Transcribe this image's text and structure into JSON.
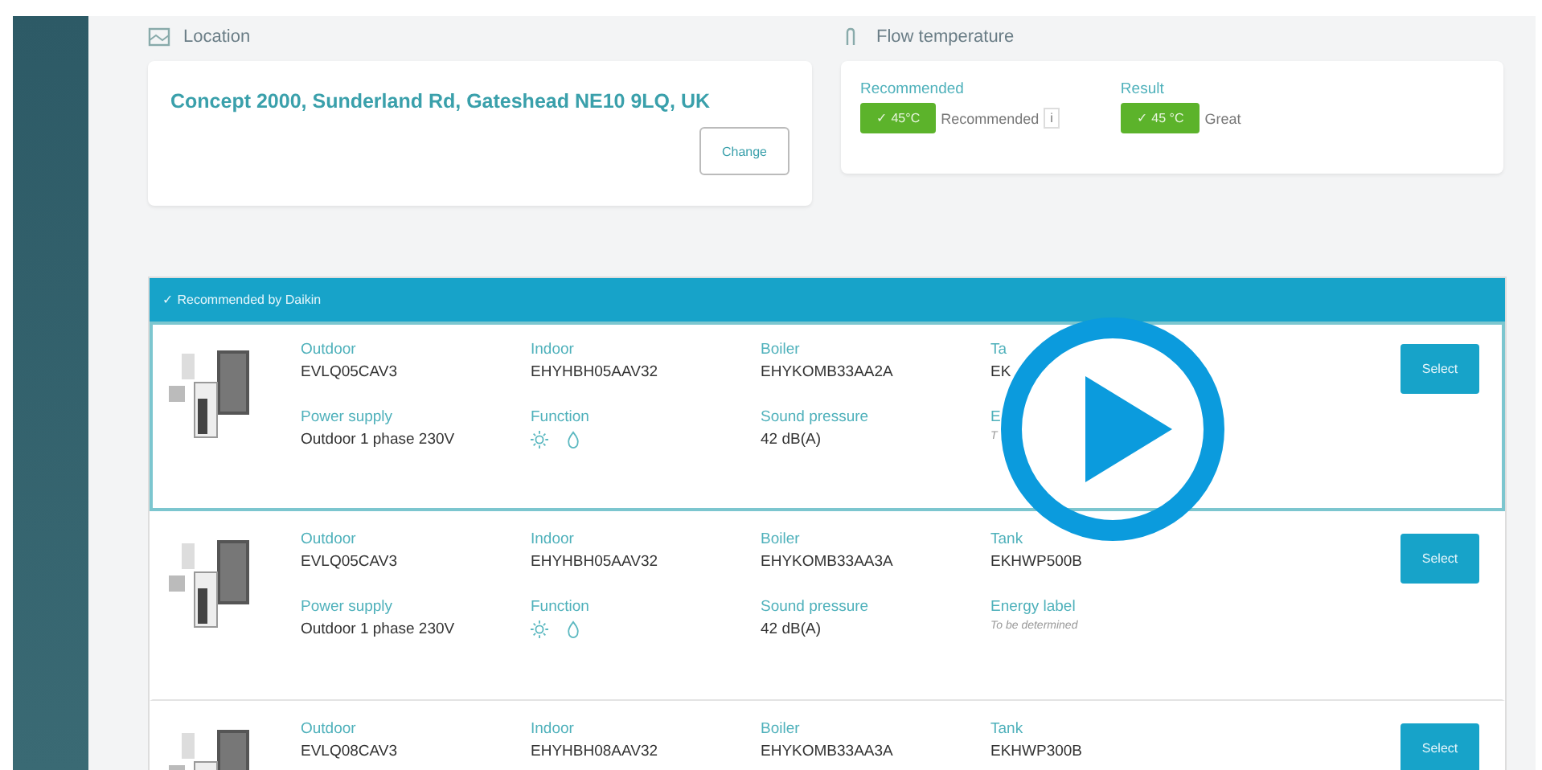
{
  "location": {
    "heading": "Location",
    "address": "Concept 2000, Sunderland Rd, Gateshead NE10 9LQ, UK",
    "button": "Change"
  },
  "flow_temperature": {
    "heading": "Flow temperature",
    "items": [
      {
        "label": "Recommended",
        "badge": "✓ 45°C",
        "note": "Recommended",
        "info": "i"
      },
      {
        "label": "Result",
        "badge": "✓ 45 °C",
        "note": "Great"
      }
    ]
  },
  "results": {
    "header": "✓ Recommended by Daikin",
    "rows": [
      {
        "recommended": true,
        "button": "Select",
        "fields": [
          {
            "kind": "text",
            "label": "Outdoor",
            "value": "EVLQ05CAV3"
          },
          {
            "kind": "text",
            "label": "Indoor",
            "value": "EHYHBH05AAV32"
          },
          {
            "kind": "text",
            "label": "Boiler",
            "value": "EHYKOMB33AA2A"
          },
          {
            "kind": "text",
            "label": "Ta",
            "value": "EK"
          },
          {
            "kind": "text",
            "label": "Power supply",
            "value": "Outdoor 1 phase 230V"
          },
          {
            "kind": "icons",
            "label": "Function"
          },
          {
            "kind": "text",
            "label": "Sound pressure",
            "value": "42 dB(A)"
          },
          {
            "kind": "note",
            "label": "E",
            "value": "T"
          }
        ]
      },
      {
        "recommended": false,
        "button": "Select",
        "fields": [
          {
            "kind": "text",
            "label": "Outdoor",
            "value": "EVLQ05CAV3"
          },
          {
            "kind": "text",
            "label": "Indoor",
            "value": "EHYHBH05AAV32"
          },
          {
            "kind": "text",
            "label": "Boiler",
            "value": "EHYKOMB33AA3A"
          },
          {
            "kind": "text",
            "label": "Tank",
            "value": "EKHWP500B"
          },
          {
            "kind": "text",
            "label": "Power supply",
            "value": "Outdoor 1 phase 230V"
          },
          {
            "kind": "icons",
            "label": "Function"
          },
          {
            "kind": "text",
            "label": "Sound pressure",
            "value": "42 dB(A)"
          },
          {
            "kind": "note",
            "label": "Energy label",
            "value": "To be determined"
          }
        ]
      },
      {
        "recommended": false,
        "button": "Select",
        "fields": [
          {
            "kind": "text",
            "label": "Outdoor",
            "value": "EVLQ08CAV3"
          },
          {
            "kind": "text",
            "label": "Indoor",
            "value": "EHYHBH08AAV32"
          },
          {
            "kind": "text",
            "label": "Boiler",
            "value": "EHYKOMB33AA3A"
          },
          {
            "kind": "text",
            "label": "Tank",
            "value": "EKHWP300B"
          }
        ]
      }
    ]
  }
}
